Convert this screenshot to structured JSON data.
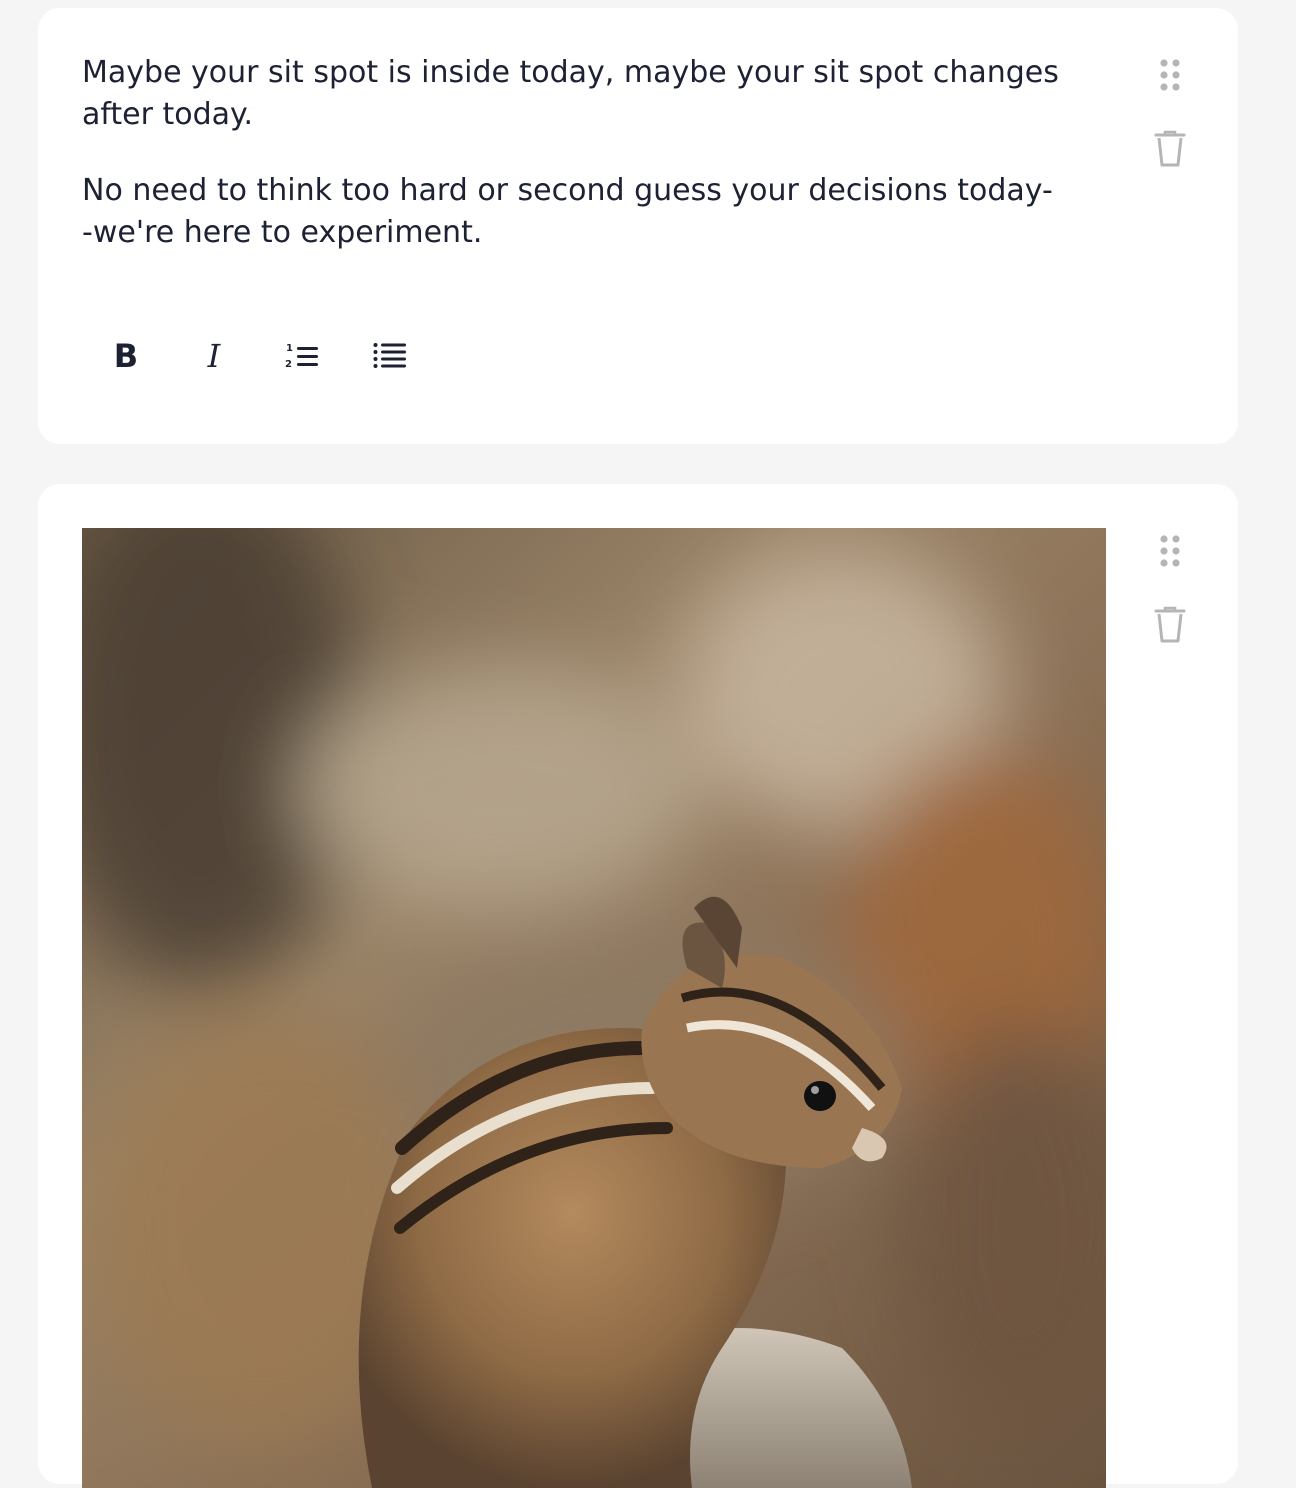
{
  "text_block": {
    "paragraphs": [
      "Maybe your sit spot is inside today, maybe your sit spot changes after today.",
      "No need to think too hard or second guess your decisions today--we're here to experiment."
    ],
    "toolbar": {
      "bold_label": "B",
      "italic_label": "I",
      "icons": [
        "bold-icon",
        "italic-icon",
        "ordered-list-icon",
        "bullet-list-icon"
      ]
    },
    "controls": [
      "drag-handle-icon",
      "trash-icon"
    ]
  },
  "image_block": {
    "subject": "photo",
    "controls": [
      "drag-handle-icon",
      "trash-icon"
    ]
  },
  "colors": {
    "page_bg": "#f5f5f5",
    "card_bg": "#ffffff",
    "text": "#1c2233",
    "icon_muted": "#b5b5b5"
  }
}
